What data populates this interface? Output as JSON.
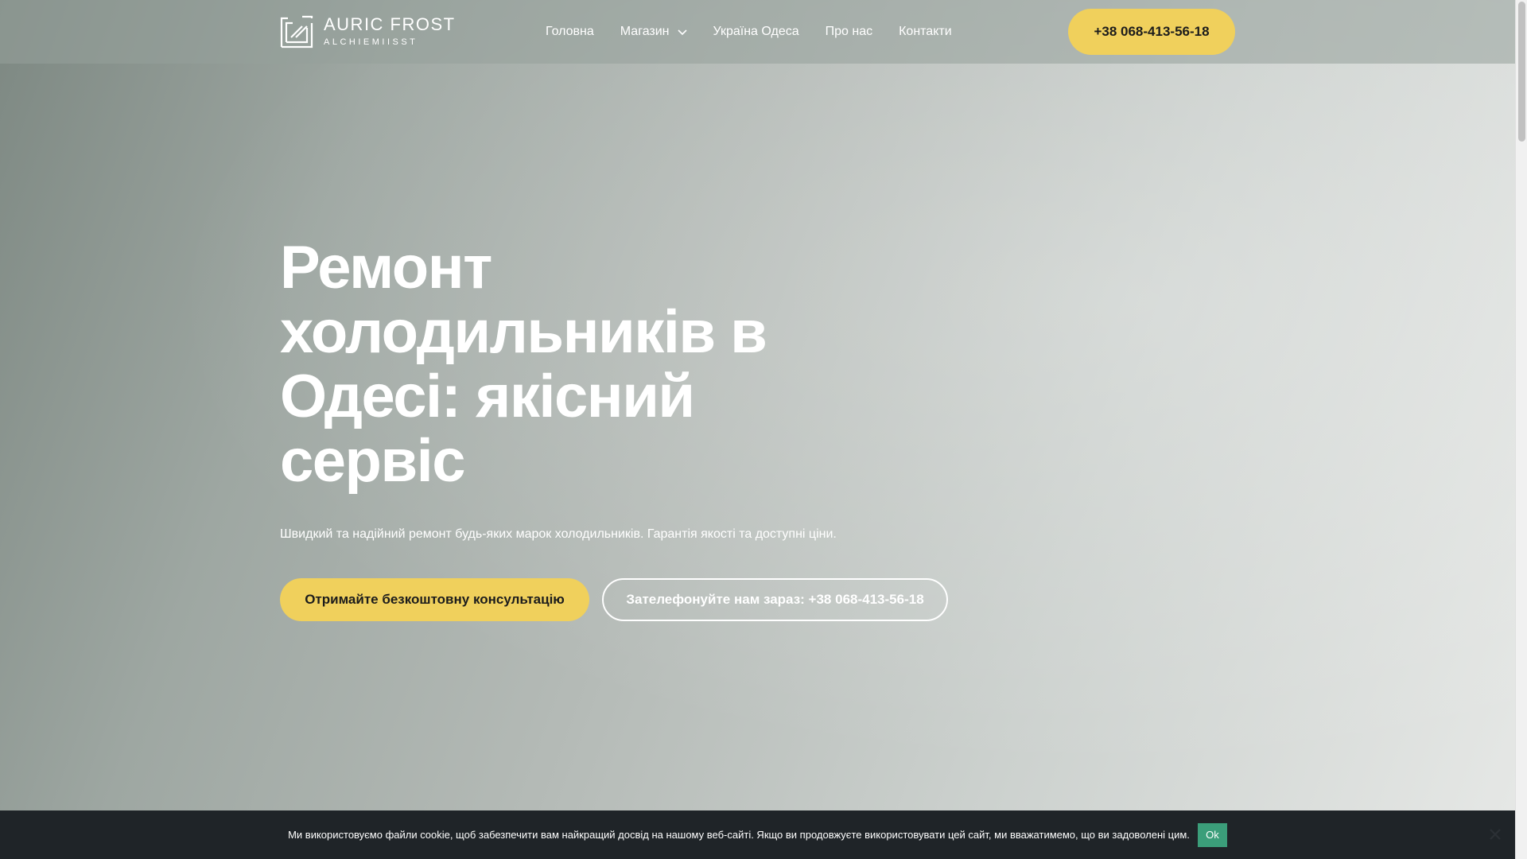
{
  "brand": {
    "name": "AURIC FROST",
    "tagline": "ALCHIEMIISST"
  },
  "nav": {
    "items": [
      {
        "label": "Головна",
        "has_dropdown": false
      },
      {
        "label": "Магазин",
        "has_dropdown": true
      },
      {
        "label": "Україна Одеса",
        "has_dropdown": false
      },
      {
        "label": "Про нас",
        "has_dropdown": false
      },
      {
        "label": "Контакти",
        "has_dropdown": false
      }
    ],
    "phone_button": "+38 068-413-56-18"
  },
  "hero": {
    "title": "Ремонт холодильників в Одесі: якісний сервіс",
    "subtitle": "Швидкий та надійний ремонт будь-яких марок холодильників. Гарантія якості та доступні ціни.",
    "primary_cta": "Отримайте безкоштовну консультацію",
    "secondary_cta": "Зателефонуйте нам зараз: +38 068-413-56-18"
  },
  "cookie": {
    "text": "Ми використовуємо файли cookie, щоб забезпечити вам найкращий досвід на нашому веб-сайті. Якщо ви продовжуєте використовувати цей сайт, ми вважатимемо, що ви задоволені цим.",
    "ok_label": "Ok"
  },
  "colors": {
    "accent": "#f0d05c",
    "cookie_bg": "#1f2428",
    "ok_button": "#3b9e7a"
  },
  "icons": {
    "logo": "logo-mark-icon",
    "dropdown": "chevron-down-icon",
    "close": "close-icon"
  }
}
